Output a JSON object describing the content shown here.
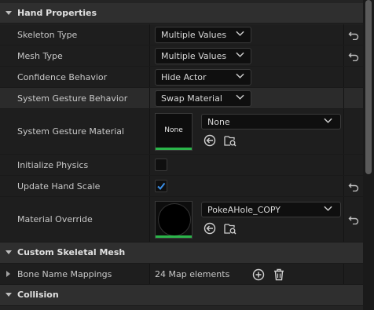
{
  "sections": {
    "hand_properties": "Hand Properties",
    "custom_skeletal_mesh": "Custom Skeletal Mesh",
    "collision": "Collision"
  },
  "rows": {
    "skeleton_type": {
      "label": "Skeleton Type",
      "value": "Multiple Values"
    },
    "mesh_type": {
      "label": "Mesh Type",
      "value": "Multiple Values"
    },
    "confidence_behavior": {
      "label": "Confidence Behavior",
      "value": "Hide Actor"
    },
    "system_gesture_behavior": {
      "label": "System Gesture Behavior",
      "value": "Swap Material"
    },
    "system_gesture_material": {
      "label": "System Gesture Material",
      "thumbnail_text": "None",
      "asset": "None"
    },
    "initialize_physics": {
      "label": "Initialize Physics",
      "checked": false
    },
    "update_hand_scale": {
      "label": "Update Hand Scale",
      "checked": true
    },
    "material_override": {
      "label": "Material Override",
      "asset": "PokeAHole_COPY"
    },
    "bone_name_mappings": {
      "label": "Bone Name Mappings",
      "value": "24 Map elements"
    }
  },
  "colors": {
    "accent_blue": "#3a8ee6",
    "thumbnail_green": "#2bb54a"
  },
  "icons": [
    "chevron-down-icon",
    "reset-arrow-icon",
    "use-selected-asset-icon",
    "browse-asset-icon",
    "add-element-icon",
    "delete-icon"
  ]
}
